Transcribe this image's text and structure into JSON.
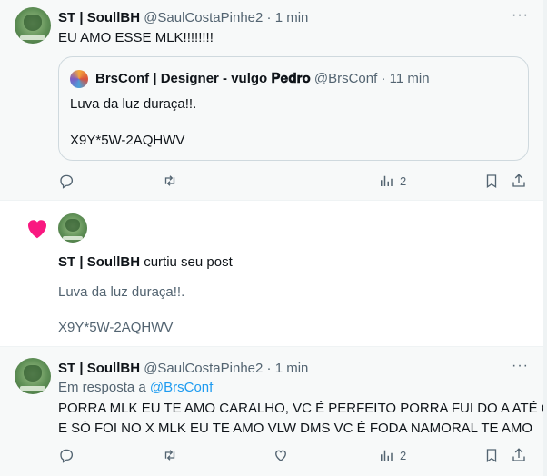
{
  "post1": {
    "name": "ST | SoullBH",
    "handle": "@SaulCostaPinhe2",
    "dot": "·",
    "time": "1 min",
    "more": "···",
    "text": "EU AMO ESSE MLK!!!!!!!!",
    "quote": {
      "name": "BrsConf | Designer - vulgo 𝐏𝐞𝐝𝐫𝐨",
      "handle": "@BrsConf",
      "dot": "·",
      "time": "11 min",
      "line1": "Luva da luz duraça!!.",
      "line2": "X9Y*5W-2AQHWV"
    },
    "views": "2"
  },
  "notif": {
    "name": "ST | SoullBH",
    "action": "curtiu seu post",
    "line1": "Luva da luz duraça!!.",
    "line2": "X9Y*5W-2AQHWV"
  },
  "post3": {
    "name": "ST | SoullBH",
    "handle": "@SaulCostaPinhe2",
    "dot": "·",
    "time": "1 min",
    "more": "···",
    "reply_prefix": "Em resposta a",
    "reply_handle": "@BrsConf",
    "line1": "PORRA MLK EU TE AMO CARALHO, VC É PERFEITO PORRA FUI DO A ATÉ O Z",
    "line2": "E SÓ FOI NO X MLK EU TE AMO VLW DMS VC É FODA NAMORAL TE AMO",
    "views": "2"
  },
  "colors": {
    "accent": "#1d9bf0",
    "muted": "#536471",
    "heart": "#f91880"
  },
  "icons": [
    "reply-icon",
    "retweet-icon",
    "views-icon",
    "bookmark-icon",
    "share-icon",
    "heart-icon"
  ]
}
